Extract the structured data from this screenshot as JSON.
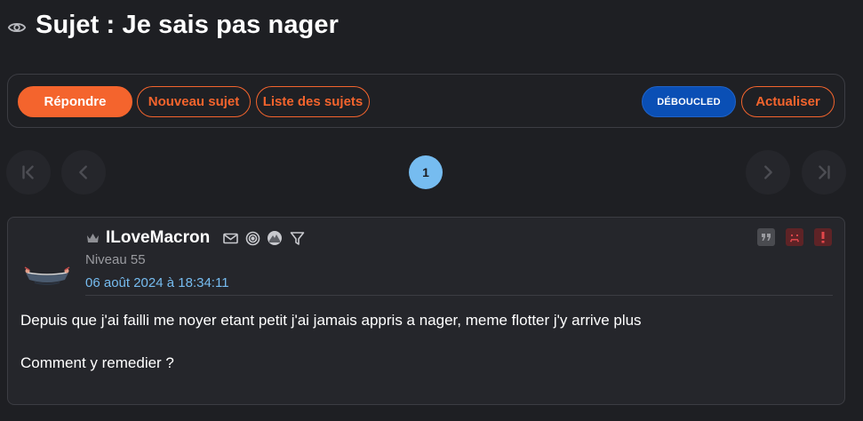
{
  "topic": {
    "title": "Sujet : Je sais pas nager",
    "icon": "eye-icon"
  },
  "toolbar": {
    "reply_label": "Répondre",
    "new_topic_label": "Nouveau sujet",
    "topic_list_label": "Liste des sujets",
    "badge_label": "DÉBOUCLED",
    "refresh_label": "Actualiser",
    "accent_color": "#f4642d",
    "badge_color": "#0a4fb5"
  },
  "pagination": {
    "current_page": "1",
    "icons": [
      "first-page-icon",
      "previous-page-icon",
      "next-page-icon",
      "last-page-icon"
    ]
  },
  "post": {
    "author": "ILoveMacron",
    "level": "Niveau 55",
    "date": "06 août 2024 à 18:34:11",
    "author_icons": [
      "crown-icon",
      "mail-icon",
      "spiral-icon",
      "badge-icon",
      "filter-icon"
    ],
    "action_icons": [
      "quote-icon",
      "blacklist-icon",
      "report-icon"
    ],
    "paragraphs": [
      "Depuis que j'ai failli me noyer etant petit j'ai jamais appris a nager, meme flotter j'y arrive plus",
      "Comment y remedier ?"
    ],
    "date_color": "#76bcf0"
  }
}
